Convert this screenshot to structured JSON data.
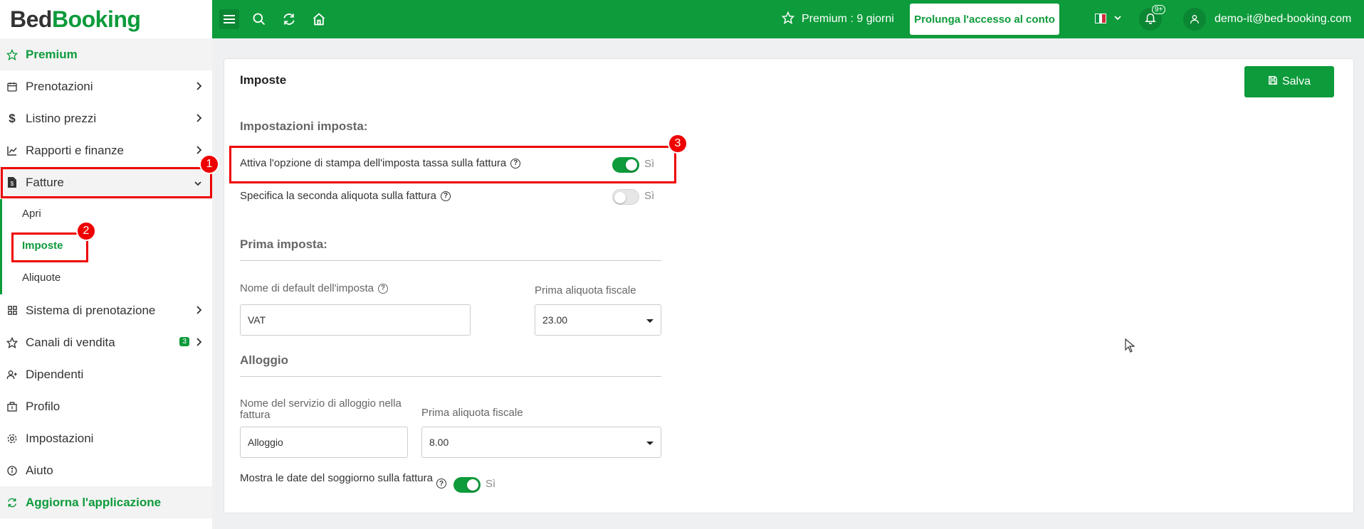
{
  "app": {
    "logo_part1": "Bed",
    "logo_part2": "Booking"
  },
  "topbar": {
    "premium_text": "Premium : 9 giorni",
    "extend_button": "Prolunga l'accesso al conto",
    "notifications_badge": "9+",
    "user_email": "demo-it@bed-booking.com",
    "language": "Italiano"
  },
  "sidebar": {
    "items": [
      {
        "label": "Premium",
        "icon": "star-icon"
      },
      {
        "label": "Prenotazioni",
        "icon": "calendar-icon"
      },
      {
        "label": "Listino prezzi",
        "icon": "dollar-icon"
      },
      {
        "label": "Rapporti e finanze",
        "icon": "chart-icon"
      },
      {
        "label": "Fatture",
        "icon": "invoice-icon"
      },
      {
        "label": "Sistema di prenotazione",
        "icon": "grid-icon"
      },
      {
        "label": "Canali di vendita",
        "icon": "star-outline-icon",
        "badge": "3"
      },
      {
        "label": "Dipendenti",
        "icon": "user-plus-icon"
      },
      {
        "label": "Profilo",
        "icon": "building-icon"
      },
      {
        "label": "Impostazioni",
        "icon": "gear-icon"
      },
      {
        "label": "Aiuto",
        "icon": "info-icon"
      },
      {
        "label": "Aggiorna l'applicazione",
        "icon": "refresh-icon"
      }
    ],
    "subitems": [
      {
        "label": "Apri"
      },
      {
        "label": "Imposte"
      },
      {
        "label": "Aliquote"
      }
    ]
  },
  "main": {
    "title": "Imposte",
    "save_button": "Salva",
    "tax_settings_heading": "Impostazioni imposta:",
    "print_tax_label": "Attiva l'opzione di stampa dell'imposta tassa sulla fattura",
    "print_tax_toggle_text": "Sì",
    "second_rate_label": "Specifica la seconda aliquota sulla fattura",
    "second_rate_toggle_text": "Sì",
    "first_tax_heading": "Prima imposta:",
    "default_tax_name_label": "Nome di default dell'imposta",
    "default_tax_name_value": "VAT",
    "first_rate_label": "Prima aliquota fiscale",
    "first_rate_value": "23.00",
    "accommodation_heading": "Alloggio",
    "accommodation_service_label": "Nome del servizio di alloggio nella fattura",
    "accommodation_service_value": "Alloggio",
    "accommodation_rate_label": "Prima aliquota fiscale",
    "accommodation_rate_value": "8.00",
    "show_dates_label": "Mostra le date del soggiorno sulla fattura",
    "show_dates_toggle_text": "Sì"
  },
  "annotations": [
    "1",
    "2",
    "3"
  ],
  "colors": {
    "brand_green": "#0d9b3b",
    "annotation_red": "#e00000"
  }
}
